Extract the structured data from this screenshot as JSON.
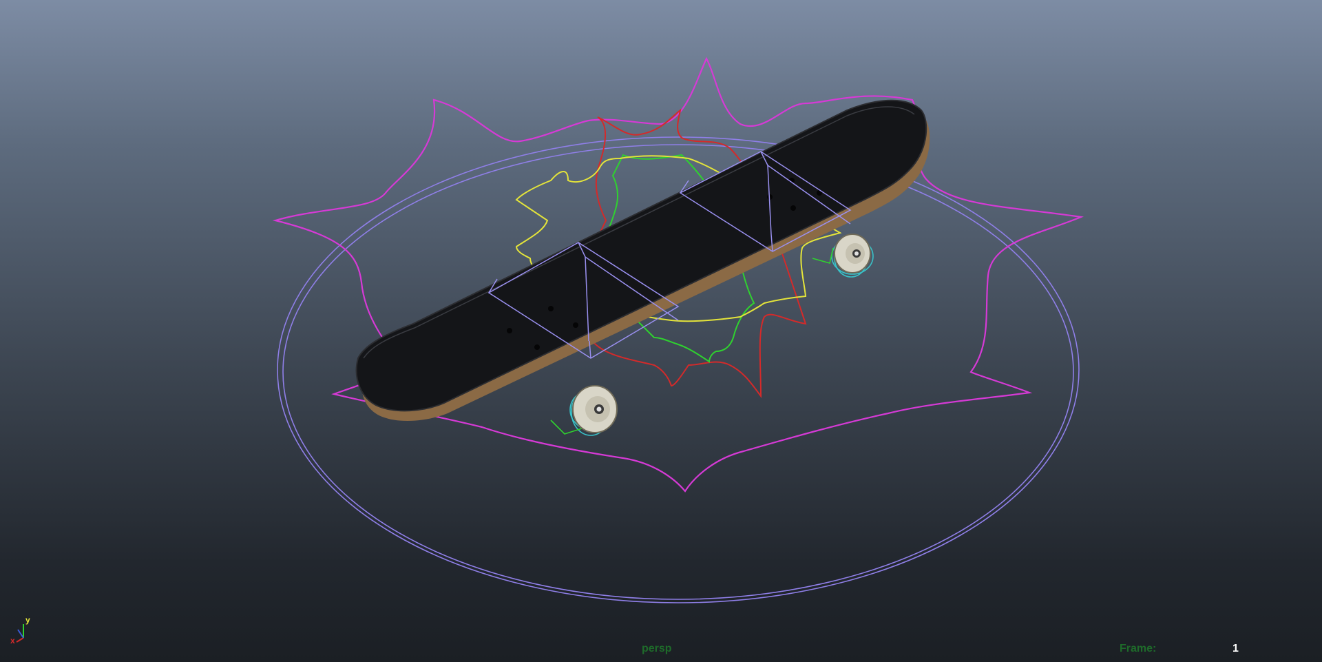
{
  "viewport": {
    "camera_name": "persp",
    "frame_label": "Frame:",
    "frame_value": "1"
  },
  "axis_gizmo": {
    "y_label": "y",
    "x_label": "x"
  },
  "colors": {
    "root_control": "#d63ad6",
    "ground_ring": "#8f7fe8",
    "red_control": "#d42a2a",
    "green_control": "#2fd22f",
    "yellow_control": "#e4e43a",
    "wheel_control": "#39c2c8",
    "truck_wire": "#9a90f0",
    "deck": "#111215",
    "deck_edge": "#8b6a45"
  },
  "scene_objects": [
    {
      "name": "skateboard-deck"
    },
    {
      "name": "front-wheel"
    },
    {
      "name": "back-wheel"
    },
    {
      "name": "root-control-star"
    },
    {
      "name": "ground-ring-control"
    }
  ]
}
